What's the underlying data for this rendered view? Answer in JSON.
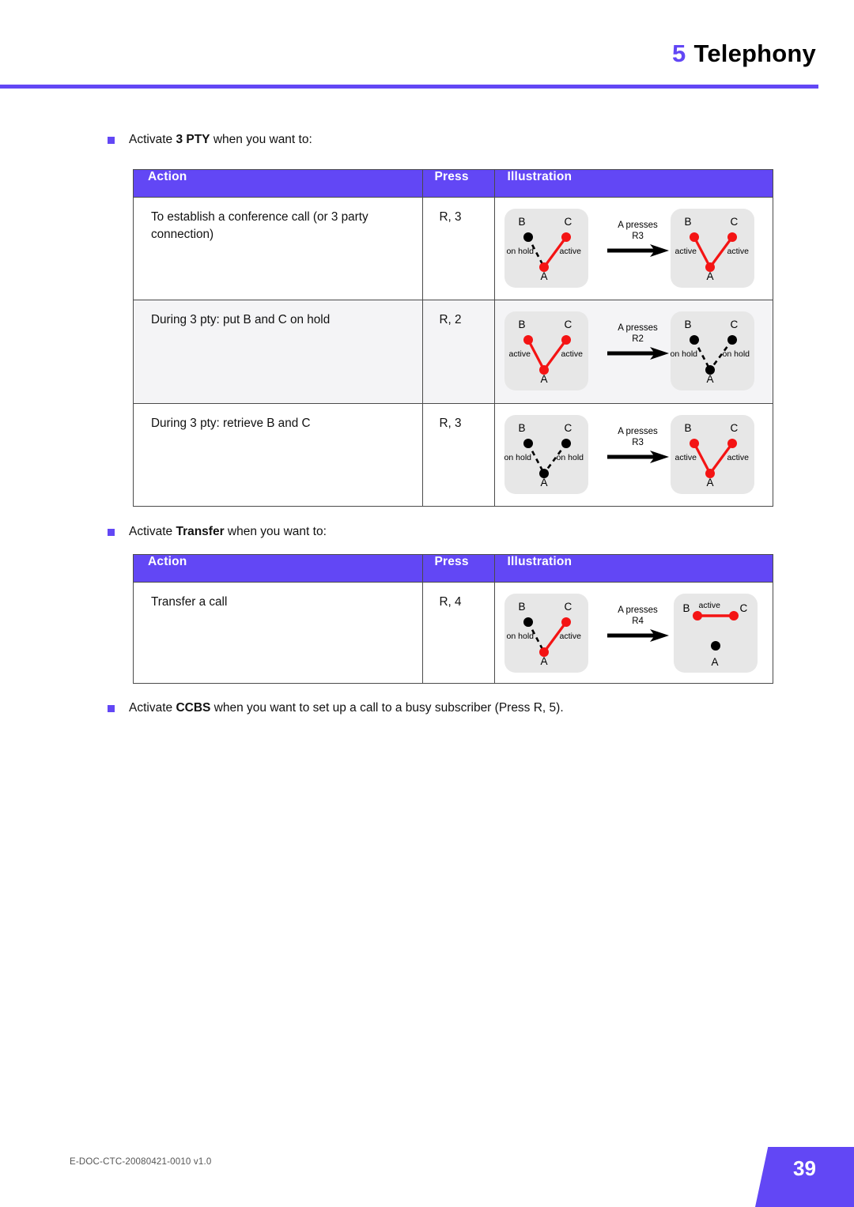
{
  "header": {
    "chapter_number": "5",
    "chapter_title": "Telephony",
    "accent_color": "#6247F5"
  },
  "intro_bullets": {
    "pty": {
      "pre": "Activate ",
      "bold": "3 PTY",
      "post": " when you want to:"
    },
    "transfer": {
      "pre": "Activate ",
      "bold": "Transfer",
      "post": " when you want to:"
    },
    "ccbs": {
      "pre": "Activate ",
      "bold": "CCBS",
      "post": " when you want to set up a call to a busy subscriber (Press R, 5)."
    }
  },
  "table_columns": {
    "action": "Action",
    "press": "Press",
    "illustration": "Illustration"
  },
  "pty_table": {
    "rows": [
      {
        "action": "To establish a conference call (or 3 party connection)",
        "press": "R, 3",
        "transition": {
          "pre": "A presses",
          "key": "R3"
        },
        "before": {
          "nodes": {
            "A": "A",
            "B": "B",
            "C": "C"
          },
          "labels": {
            "left": "on hold",
            "right": "active"
          }
        },
        "after": {
          "nodes": {
            "A": "A",
            "B": "B",
            "C": "C"
          },
          "labels": {
            "left": "active",
            "right": "active"
          }
        }
      },
      {
        "action": "During 3 pty: put B and C on hold",
        "press": "R, 2",
        "transition": {
          "pre": "A presses",
          "key": "R2"
        },
        "before": {
          "nodes": {
            "A": "A",
            "B": "B",
            "C": "C"
          },
          "labels": {
            "left": "active",
            "right": "active"
          }
        },
        "after": {
          "nodes": {
            "A": "A",
            "B": "B",
            "C": "C"
          },
          "labels": {
            "left": "on hold",
            "right": "on hold"
          }
        }
      },
      {
        "action": "During 3 pty: retrieve B and C",
        "press": "R, 3",
        "transition": {
          "pre": "A presses",
          "key": "R3"
        },
        "before": {
          "nodes": {
            "A": "A",
            "B": "B",
            "C": "C"
          },
          "labels": {
            "left": "on hold",
            "right": "on hold"
          }
        },
        "after": {
          "nodes": {
            "A": "A",
            "B": "B",
            "C": "C"
          },
          "labels": {
            "left": "active",
            "right": "active"
          }
        }
      }
    ]
  },
  "transfer_table": {
    "rows": [
      {
        "action": "Transfer a call",
        "press": "R, 4",
        "transition": {
          "pre": "A presses",
          "key": "R4"
        },
        "before": {
          "nodes": {
            "A": "A",
            "B": "B",
            "C": "C"
          },
          "labels": {
            "left": "on hold",
            "right": "active"
          }
        },
        "after": {
          "nodes": {
            "A": "A",
            "B": "B",
            "C": "C"
          },
          "labels": {
            "top": "active"
          }
        }
      }
    ]
  },
  "footer": {
    "doc_id": "E-DOC-CTC-20080421-0010 v1.0",
    "page_number": "39"
  }
}
